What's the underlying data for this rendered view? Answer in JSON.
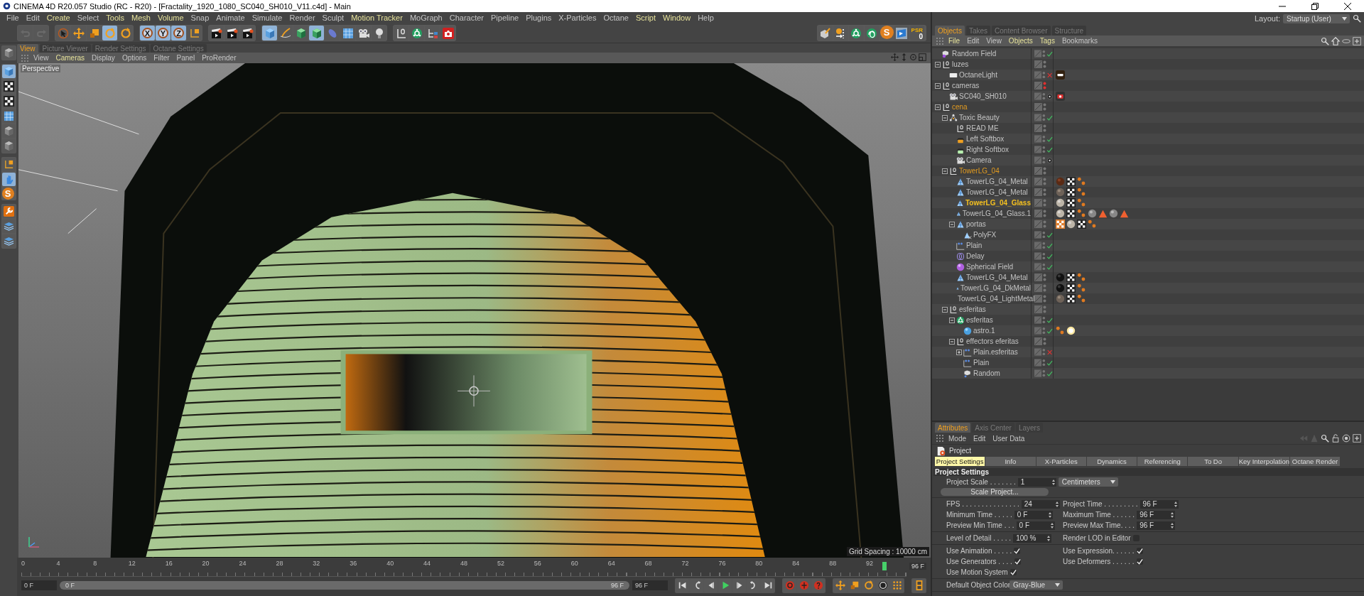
{
  "window": {
    "title": "CINEMA 4D R20.057 Studio (RC - R20) - [Fractality_1920_1080_SC040_SH010_V11.c4d] - Main"
  },
  "menu": [
    {
      "label": "File",
      "highlight": false
    },
    {
      "label": "Edit",
      "highlight": false
    },
    {
      "label": "Create",
      "highlight": true
    },
    {
      "label": "Select",
      "highlight": false
    },
    {
      "label": "Tools",
      "highlight": true
    },
    {
      "label": "Mesh",
      "highlight": true
    },
    {
      "label": "Volume",
      "highlight": true
    },
    {
      "label": "Snap",
      "highlight": false
    },
    {
      "label": "Animate",
      "highlight": false
    },
    {
      "label": "Simulate",
      "highlight": false
    },
    {
      "label": "Render",
      "highlight": false
    },
    {
      "label": "Sculpt",
      "highlight": false
    },
    {
      "label": "Motion Tracker",
      "highlight": true
    },
    {
      "label": "MoGraph",
      "highlight": false
    },
    {
      "label": "Character",
      "highlight": false
    },
    {
      "label": "Pipeline",
      "highlight": false
    },
    {
      "label": "Plugins",
      "highlight": false
    },
    {
      "label": "X-Particles",
      "highlight": false
    },
    {
      "label": "Octane",
      "highlight": false
    },
    {
      "label": "Script",
      "highlight": true
    },
    {
      "label": "Window",
      "highlight": true
    },
    {
      "label": "Help",
      "highlight": false
    }
  ],
  "toolbar": [
    [
      {
        "kind": "undo",
        "selected": false
      },
      {
        "kind": "redo",
        "selected": false
      }
    ],
    [
      {
        "kind": "cursor",
        "selected": false
      },
      {
        "kind": "move",
        "selected": false
      },
      {
        "kind": "scale",
        "selected": false
      },
      {
        "kind": "rotate",
        "selected": true
      },
      {
        "kind": "rotate",
        "selected": false
      }
    ],
    [
      {
        "kind": "axis",
        "label": "X",
        "selected": true
      },
      {
        "kind": "axis",
        "label": "Y",
        "selected": true
      },
      {
        "kind": "axis",
        "label": "Z",
        "selected": true
      },
      {
        "kind": "coord",
        "selected": false
      }
    ],
    [
      {
        "kind": "clapper",
        "selected": false
      },
      {
        "kind": "clapper",
        "selected": false
      },
      {
        "kind": "clapper",
        "selected": false
      }
    ],
    [
      {
        "kind": "cube",
        "selected": true
      },
      {
        "kind": "pen",
        "selected": false
      },
      {
        "kind": "greencube",
        "selected": false
      },
      {
        "kind": "greencube",
        "selected": true
      },
      {
        "kind": "capsule",
        "selected": false
      },
      {
        "kind": "floor",
        "selected": false
      },
      {
        "kind": "camera",
        "selected": false
      },
      {
        "kind": "bulb",
        "selected": false
      }
    ],
    [
      {
        "kind": "null",
        "selected": false
      },
      {
        "kind": "cloner",
        "selected": false
      },
      {
        "kind": "hierarchy",
        "selected": false
      },
      {
        "kind": "record",
        "selected": false
      }
    ]
  ],
  "toolbar_right": [
    {
      "kind": "brush"
    },
    {
      "kind": "xyz"
    },
    {
      "kind": "cloner"
    },
    {
      "kind": "knot"
    },
    {
      "kind": "letter",
      "label": "S"
    },
    {
      "kind": "film"
    },
    {
      "kind": "psr",
      "label": "PSR",
      "value": "0"
    }
  ],
  "left_toolbar": [
    [
      {
        "kind": "greycube",
        "selected": false
      }
    ],
    [
      {
        "kind": "cube",
        "selected": true
      },
      {
        "kind": "checker",
        "selected": false
      },
      {
        "kind": "checker",
        "selected": false
      },
      {
        "kind": "floor",
        "selected": false
      },
      {
        "kind": "greycube",
        "selected": false
      },
      {
        "kind": "greycube",
        "selected": false
      }
    ],
    [
      {
        "kind": "coord",
        "selected": false
      },
      {
        "kind": "hand",
        "selected": true
      },
      {
        "kind": "letter",
        "label": "S"
      }
    ],
    [
      {
        "kind": "wrench",
        "selected": false
      },
      {
        "kind": "layers",
        "selected": false
      },
      {
        "kind": "layers",
        "selected": false
      }
    ]
  ],
  "viewport": {
    "tabs": [
      {
        "label": "View",
        "selected": true
      },
      {
        "label": "Picture Viewer",
        "selected": false
      },
      {
        "label": "Render Settings",
        "selected": false
      },
      {
        "label": "Octane Settings",
        "selected": false
      }
    ],
    "menu": [
      {
        "label": "View",
        "highlight": false
      },
      {
        "label": "Cameras",
        "highlight": true
      },
      {
        "label": "Display",
        "highlight": false
      },
      {
        "label": "Options",
        "highlight": false
      },
      {
        "label": "Filter",
        "highlight": false
      },
      {
        "label": "Panel",
        "highlight": false
      },
      {
        "label": "ProRender",
        "highlight": false
      }
    ],
    "camera": "Perspective",
    "grid_spacing": "Grid Spacing : 10000 cm"
  },
  "timeline": {
    "range": {
      "level": 1
    },
    "ticks": [
      "0",
      "4",
      "8",
      "12",
      "16",
      "20",
      "24",
      "28",
      "32",
      "36",
      "40",
      "44",
      "48",
      "52",
      "56",
      "60",
      "64",
      "68",
      "72",
      "76",
      "80",
      "84",
      "88",
      "92"
    ],
    "playhead": {
      "level": 0.975
    },
    "current": "96 F",
    "start": "0 F",
    "range_start": "0 F",
    "range_end": "96 F",
    "end": "96 F"
  },
  "layout": {
    "label": "Layout:",
    "value": "Startup (User)"
  },
  "objects": {
    "tabs": [
      {
        "label": "Objects",
        "selected": true
      },
      {
        "label": "Takes",
        "selected": false
      },
      {
        "label": "Content Browser",
        "selected": false
      },
      {
        "label": "Structure",
        "selected": false
      }
    ],
    "menu": [
      {
        "label": "File",
        "highlight": true
      },
      {
        "label": "Edit",
        "highlight": false
      },
      {
        "label": "View",
        "highlight": false
      },
      {
        "label": "Objects",
        "highlight": true
      },
      {
        "label": "Tags",
        "highlight": true
      },
      {
        "label": "Bookmarks",
        "highlight": false
      }
    ],
    "tree": [
      {
        "name": "Random Field",
        "kind": "field",
        "status": {
          "kind": "check"
        },
        "selected": false
      },
      {
        "name": "luzes",
        "kind": "null",
        "selected": false,
        "expanded": true,
        "children": [
          {
            "name": "OctaneLight",
            "kind": "light",
            "status": {
              "kind": "cross"
            },
            "selected": false,
            "tags": [
              {
                "kind": "light"
              }
            ]
          }
        ]
      },
      {
        "name": "cameras",
        "kind": "null",
        "hidden": true,
        "selected": false,
        "expanded": true,
        "children": [
          {
            "name": "SC040_SH010",
            "kind": "camera",
            "status": {
              "kind": "target"
            },
            "selected": false,
            "tags": [
              {
                "kind": "camera"
              }
            ]
          }
        ]
      },
      {
        "name": "cena",
        "kind": "null",
        "selected": true,
        "expanded": true,
        "children": [
          {
            "name": "Toxic Beauty",
            "kind": "group",
            "status": {
              "kind": "check"
            },
            "selected": false,
            "expanded": true,
            "children": [
              {
                "name": "READ ME",
                "kind": "null",
                "selected": false
              },
              {
                "name": "Left Softbox",
                "kind": "softbox-orange",
                "status": {
                  "kind": "check"
                },
                "selected": false
              },
              {
                "name": "Right Softbox",
                "kind": "softbox-green",
                "status": {
                  "kind": "check"
                },
                "selected": false
              },
              {
                "name": "Camera",
                "kind": "camera",
                "status": {
                  "kind": "target"
                },
                "selected": false
              }
            ]
          },
          {
            "name": "TowerLG_04",
            "kind": "null",
            "selected": true,
            "expanded": true,
            "children": [
              {
                "name": "TowerLG_04_Metal",
                "kind": "polygon",
                "selected": false,
                "tags": [
                  {
                    "kind": "ball-brown"
                  },
                  {
                    "kind": "checker"
                  },
                  {
                    "kind": "dots"
                  }
                ]
              },
              {
                "name": "TowerLG_04_Metal",
                "kind": "polygon",
                "selected": false,
                "tags": [
                  {
                    "kind": "ball-grey"
                  },
                  {
                    "kind": "checker"
                  },
                  {
                    "kind": "dots"
                  }
                ]
              },
              {
                "name": "TowerLG_04_Glass",
                "kind": "polygon",
                "selected": true,
                "active": true,
                "tags": [
                  {
                    "kind": "ball-light"
                  },
                  {
                    "kind": "checker"
                  },
                  {
                    "kind": "dots"
                  }
                ]
              },
              {
                "name": "TowerLG_04_Glass.1",
                "kind": "polygon",
                "selected": false,
                "tags": [
                  {
                    "kind": "ball-light"
                  },
                  {
                    "kind": "checker"
                  },
                  {
                    "kind": "dots"
                  },
                  {
                    "kind": "ball-metal"
                  },
                  {
                    "kind": "cone"
                  },
                  {
                    "kind": "ball-metal"
                  },
                  {
                    "kind": "cone"
                  }
                ]
              },
              {
                "name": "portas",
                "kind": "polygon",
                "selected": false,
                "expanded": true,
                "tags": [
                  {
                    "kind": "checker-orange"
                  },
                  {
                    "kind": "ball-light"
                  },
                  {
                    "kind": "checker"
                  },
                  {
                    "kind": "dots"
                  }
                ],
                "children": [
                  {
                    "name": "PolyFX",
                    "kind": "effector",
                    "status": {
                      "kind": "check"
                    },
                    "selected": false
                  }
                ]
              },
              {
                "name": "Plain",
                "kind": "plain",
                "status": {
                  "kind": "check"
                },
                "selected": false
              },
              {
                "name": "Delay",
                "kind": "delay",
                "status": {
                  "kind": "check"
                },
                "selected": false
              },
              {
                "name": "Spherical Field",
                "kind": "sphere-field",
                "status": {
                  "kind": "check"
                },
                "selected": false
              },
              {
                "name": "TowerLG_04_Metal",
                "kind": "polygon",
                "selected": false,
                "tags": [
                  {
                    "kind": "ball-black"
                  },
                  {
                    "kind": "checker"
                  },
                  {
                    "kind": "dots"
                  }
                ]
              },
              {
                "name": "TowerLG_04_DkMetal",
                "kind": "polygon",
                "selected": false,
                "tags": [
                  {
                    "kind": "ball-black"
                  },
                  {
                    "kind": "checker"
                  },
                  {
                    "kind": "dots"
                  }
                ]
              },
              {
                "name": "TowerLG_04_LightMetal",
                "kind": "polygon",
                "selected": false,
                "tags": [
                  {
                    "kind": "ball-grey"
                  },
                  {
                    "kind": "checker"
                  },
                  {
                    "kind": "dots"
                  }
                ]
              }
            ]
          },
          {
            "name": "esferitas",
            "kind": "null",
            "selected": false,
            "expanded": true,
            "children": [
              {
                "name": "esferitas",
                "kind": "cloner",
                "status": {
                  "kind": "check"
                },
                "selected": false,
                "expanded": true,
                "children": [
                  {
                    "name": "astro.1",
                    "kind": "sphere",
                    "status": {
                      "kind": "check"
                    },
                    "selected": false,
                    "tags": [
                      {
                        "kind": "dots"
                      },
                      {
                        "kind": "sun"
                      }
                    ]
                  }
                ]
              },
              {
                "name": "effectors eferitas",
                "kind": "null",
                "selected": false,
                "expanded": true,
                "children": [
                  {
                    "name": "Plain.esferitas",
                    "kind": "plain",
                    "status": {
                      "kind": "cross"
                    },
                    "selected": false,
                    "expanded": false
                  },
                  {
                    "name": "Plain",
                    "kind": "plain",
                    "status": {
                      "kind": "check"
                    },
                    "selected": false
                  },
                  {
                    "name": "Random",
                    "kind": "random",
                    "status": {
                      "kind": "check"
                    },
                    "selected": false
                  }
                ]
              }
            ]
          }
        ]
      }
    ]
  },
  "attributes": {
    "tabs": [
      {
        "label": "Attributes",
        "selected": true
      },
      {
        "label": "Axis Center",
        "selected": false
      },
      {
        "label": "Layers",
        "selected": false
      }
    ],
    "menu": [
      "Mode",
      "Edit",
      "User Data"
    ],
    "title": "Project",
    "subtabs": [
      {
        "label": "Project Settings",
        "selected": true
      },
      {
        "label": "Info",
        "selected": false
      },
      {
        "label": "X-Particles",
        "selected": false
      },
      {
        "label": "Dynamics",
        "selected": false
      },
      {
        "label": "Referencing",
        "selected": false
      },
      {
        "label": "To Do",
        "selected": false
      },
      {
        "label": "Key Interpolation",
        "selected": false
      },
      {
        "label": "Octane Render",
        "selected": false
      }
    ],
    "heading": "Project Settings",
    "sections": [
      [
        {
          "kind": "number",
          "label": "Project Scale . . . . . . .",
          "value": "1",
          "unit": "Centimeters"
        },
        {
          "kind": "button",
          "label": "Scale Project..."
        }
      ],
      [
        {
          "kind": "number",
          "label": "FPS . . . . . . . . . . . . . . .",
          "value": "24"
        },
        {
          "kind": "number",
          "label": "Project Time . . . . . . . . .",
          "value": "96 F"
        },
        {
          "kind": "number",
          "label": "Minimum Time . . . . .",
          "value": "0 F"
        },
        {
          "kind": "number",
          "label": "Maximum Time . . . . . .",
          "value": "96 F"
        },
        {
          "kind": "number",
          "label": "Preview Min Time . . .",
          "value": "0 F"
        },
        {
          "kind": "number",
          "label": "Preview Max Time. . . .",
          "value": "96 F"
        }
      ],
      [
        {
          "kind": "number",
          "label": "Level of Detail . . . . .",
          "value": "100 %"
        },
        {
          "kind": "checkbox",
          "label": "Render LOD in Editor",
          "checked": false
        }
      ],
      [
        {
          "kind": "checkbox",
          "label": "Use Animation . . . . .",
          "checked": true
        },
        {
          "kind": "checkbox",
          "label": "Use Expression. . . . . .",
          "checked": true
        },
        {
          "kind": "checkbox",
          "label": "Use Generators . . . .",
          "checked": true
        },
        {
          "kind": "checkbox",
          "label": "Use Deformers . . . . . .",
          "checked": true
        },
        {
          "kind": "checkbox",
          "label": "Use Motion System",
          "checked": true
        }
      ],
      [
        {
          "kind": "dropdown",
          "label": "Default Object Color",
          "value": "Gray-Blue"
        }
      ]
    ]
  }
}
